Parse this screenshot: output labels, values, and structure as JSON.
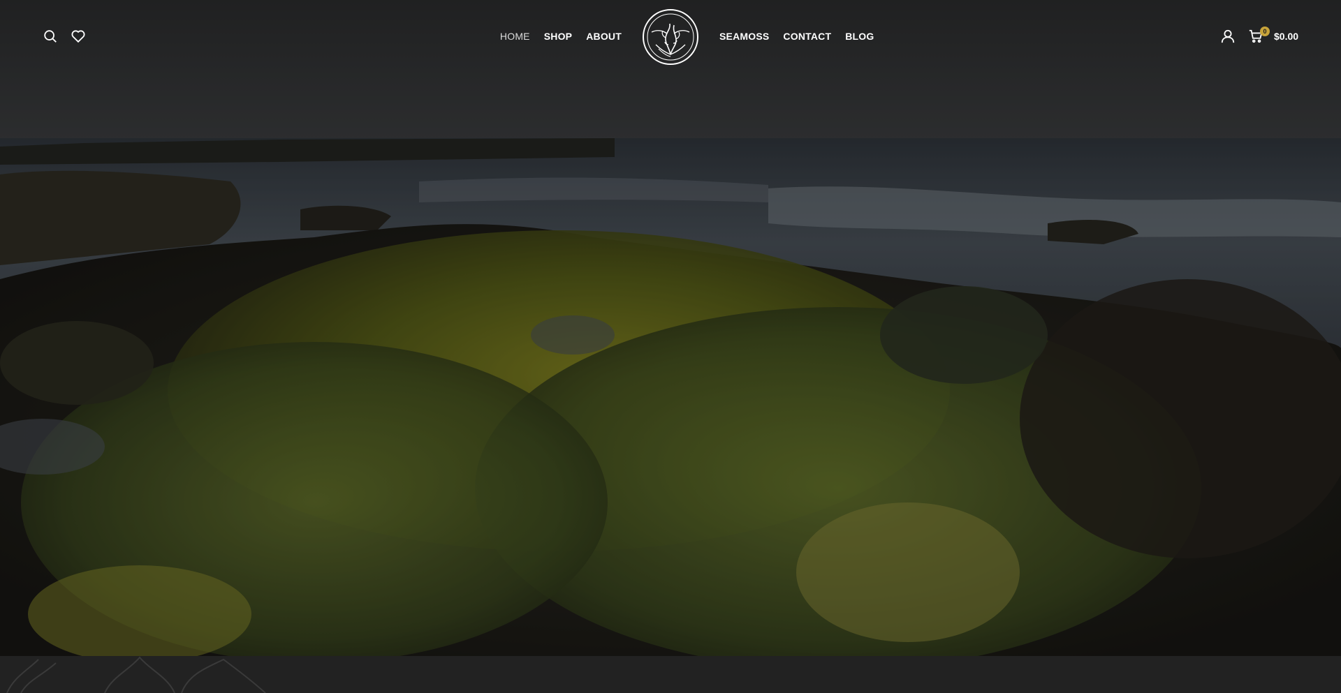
{
  "header": {
    "nav_left": [
      {
        "label": "HOME",
        "active": true
      },
      {
        "label": "SHOP",
        "active": false
      },
      {
        "label": "ABOUT",
        "active": false
      }
    ],
    "nav_right": [
      {
        "label": "SEAMOSS",
        "active": false
      },
      {
        "label": "CONTACT",
        "active": false
      },
      {
        "label": "BLOG",
        "active": false
      }
    ],
    "cart": {
      "count": "0",
      "total": "$0.00"
    },
    "icons": {
      "search": "search-icon",
      "wishlist": "heart-icon",
      "account": "user-icon",
      "cart": "cart-icon",
      "logo": "seamoss-logo"
    }
  },
  "colors": {
    "badge": "#c7a33a",
    "nav_text": "#ffffff",
    "footer_band": "#222222"
  }
}
